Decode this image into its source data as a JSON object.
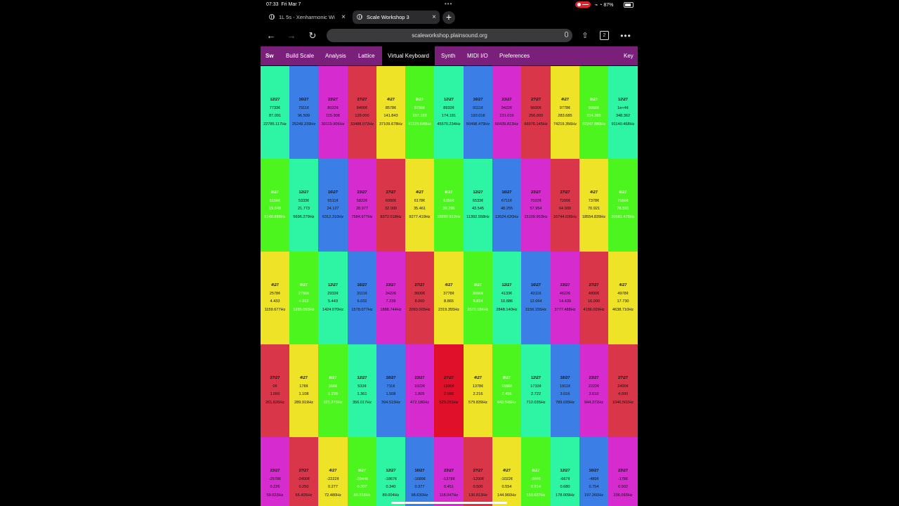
{
  "status_bar": {
    "time": "07:33",
    "date": "Fri Mar 7",
    "battery": "87%"
  },
  "browser": {
    "tabs": [
      {
        "title": "1L 5s - Xenharmonic Wi",
        "close": "×"
      },
      {
        "title": "Scale Workshop 3",
        "close": "×"
      }
    ],
    "new_tab": "+",
    "url": "scaleworkshop.plainsound.org",
    "tab_count": "2",
    "icons": {
      "back": "arrow-left-icon",
      "forward": "arrow-right-icon",
      "reload": "reload-icon",
      "share": "share-icon",
      "more": "more-icon"
    },
    "glyphs": {
      "back": "←",
      "forward": "→",
      "reload": "↻",
      "share": "⇧",
      "more": "•••"
    }
  },
  "app_nav": {
    "items": [
      "Sw",
      "Build Scale",
      "Analysis",
      "Lattice",
      "Virtual Keyboard",
      "Synth",
      "MIDI I/O",
      "Preferences",
      "Key"
    ],
    "active": "Virtual Keyboard"
  },
  "colors": {
    "teal": "#2df5a3",
    "blue": "#3b7ee6",
    "magenta": "#d62ccf",
    "red": "#d9364a",
    "red_active": "#e0102a",
    "yellow": "#efe327",
    "lime": "#4df51f",
    "nav_bg": "#7a1f7a"
  },
  "keyboard": {
    "rows": [
      [
        {
          "color": "teal",
          "lines": [
            "12\\27",
            "7733¢",
            "87.091",
            "22785.117Hz"
          ]
        },
        {
          "color": "blue",
          "lines": [
            "16\\27",
            "7911¢",
            "96.509",
            "25249.239Hz"
          ]
        },
        {
          "color": "magenta",
          "lines": [
            "23\\27",
            "8022¢",
            "115.908",
            "30119.906Hz"
          ]
        },
        {
          "color": "red",
          "lines": [
            "27\\27",
            "8400¢",
            "128.000",
            "33488.072Hz"
          ]
        },
        {
          "color": "yellow",
          "lines": [
            "4\\27",
            "8578¢",
            "141.843",
            "37109.678Hz"
          ]
        },
        {
          "color": "lime",
          "lines": [
            "8\\27",
            "8756¢",
            "157.183",
            "41123.649Hz"
          ]
        },
        {
          "color": "teal",
          "lines": [
            "12\\27",
            "8933¢",
            "174.181",
            "45570.234Hz"
          ]
        },
        {
          "color": "blue",
          "lines": [
            "16\\27",
            "9111¢",
            "193.018",
            "50498.479Hz"
          ]
        },
        {
          "color": "magenta",
          "lines": [
            "23\\27",
            "9422¢",
            "231.016",
            "60439.813Hz"
          ]
        },
        {
          "color": "red",
          "lines": [
            "27\\27",
            "9600¢",
            "256.000",
            "66976.145Hz"
          ]
        },
        {
          "color": "yellow",
          "lines": [
            "4\\27",
            "9778¢",
            "283.685",
            "74219.356Hz"
          ]
        },
        {
          "color": "lime",
          "lines": [
            "8\\27",
            "9956¢",
            "314.365",
            "82247.880Hz"
          ]
        },
        {
          "color": "teal",
          "lines": [
            "12\\27",
            "1e+4¢",
            "348.362",
            "91140.468Hz"
          ]
        }
      ],
      [
        {
          "color": "lime",
          "lines": [
            "8\\27",
            "5156¢",
            "19.648",
            "5140.889Hz"
          ]
        },
        {
          "color": "teal",
          "lines": [
            "12\\27",
            "5333¢",
            "21.773",
            "5696.279Hz"
          ]
        },
        {
          "color": "blue",
          "lines": [
            "16\\27",
            "5511¢",
            "24.127",
            "6312.310Hz"
          ]
        },
        {
          "color": "magenta",
          "lines": [
            "23\\27",
            "5822¢",
            "28.977",
            "7584.977Hz"
          ]
        },
        {
          "color": "red",
          "lines": [
            "27\\27",
            "6000¢",
            "32.000",
            "8372.018Hz"
          ]
        },
        {
          "color": "yellow",
          "lines": [
            "4\\27",
            "6178¢",
            "35.461",
            "9277.419Hz"
          ]
        },
        {
          "color": "lime",
          "lines": [
            "8\\27",
            "6356¢",
            "39.296",
            "10280.912Hz"
          ]
        },
        {
          "color": "teal",
          "lines": [
            "12\\27",
            "6533¢",
            "43.545",
            "11392.558Hz"
          ]
        },
        {
          "color": "blue",
          "lines": [
            "16\\27",
            "6711¢",
            "48.255",
            "12624.620Hz"
          ]
        },
        {
          "color": "magenta",
          "lines": [
            "23\\27",
            "7022¢",
            "57.954",
            "15109.953Hz"
          ]
        },
        {
          "color": "red",
          "lines": [
            "27\\27",
            "7200¢",
            "64.000",
            "16744.036Hz"
          ]
        },
        {
          "color": "yellow",
          "lines": [
            "4\\27",
            "7378¢",
            "70.921",
            "18554.839Hz"
          ]
        },
        {
          "color": "lime",
          "lines": [
            "8\\27",
            "7556¢",
            "78.591",
            "20561.478Hz"
          ]
        }
      ],
      [
        {
          "color": "yellow",
          "lines": [
            "4\\27",
            "2578¢",
            "4.433",
            "1159.677Hz"
          ]
        },
        {
          "color": "lime",
          "lines": [
            "8\\27",
            "2756¢",
            "4.912",
            "1285.093Hz"
          ]
        },
        {
          "color": "teal",
          "lines": [
            "12\\27",
            "2933¢",
            "5.443",
            "1424.070Hz"
          ]
        },
        {
          "color": "blue",
          "lines": [
            "16\\27",
            "3111¢",
            "6.032",
            "1578.077Hz"
          ]
        },
        {
          "color": "magenta",
          "lines": [
            "23\\27",
            "3422¢",
            "7.239",
            "1888.744Hz"
          ]
        },
        {
          "color": "red",
          "lines": [
            "27\\27",
            "3600¢",
            "8.000",
            "2093.005Hz"
          ]
        },
        {
          "color": "yellow",
          "lines": [
            "4\\27",
            "3778¢",
            "8.865",
            "2319.355Hz"
          ]
        },
        {
          "color": "lime",
          "lines": [
            "8\\27",
            "3956¢",
            "9.824",
            "2570.184Hz"
          ]
        },
        {
          "color": "teal",
          "lines": [
            "12\\27",
            "4133¢",
            "10.886",
            "2848.140Hz"
          ]
        },
        {
          "color": "blue",
          "lines": [
            "16\\27",
            "4311¢",
            "12.064",
            "3156.155Hz"
          ]
        },
        {
          "color": "magenta",
          "lines": [
            "23\\27",
            "4622¢",
            "14.439",
            "3777.488Hz"
          ]
        },
        {
          "color": "red",
          "lines": [
            "27\\27",
            "4800¢",
            "16.000",
            "4186.009Hz"
          ]
        },
        {
          "color": "yellow",
          "lines": [
            "4\\27",
            "4978¢",
            "17.730",
            "4638.710Hz"
          ]
        }
      ],
      [
        {
          "color": "red",
          "lines": [
            "27\\27",
            "0¢",
            "1.000",
            "261.626Hz"
          ]
        },
        {
          "color": "yellow",
          "lines": [
            "4\\27",
            "178¢",
            "1.108",
            "289.919Hz"
          ]
        },
        {
          "color": "lime",
          "lines": [
            "8\\27",
            "356¢",
            "1.228",
            "321.273Hz"
          ]
        },
        {
          "color": "teal",
          "lines": [
            "12\\27",
            "533¢",
            "1.361",
            "356.017Hz"
          ]
        },
        {
          "color": "blue",
          "lines": [
            "16\\27",
            "711¢",
            "1.508",
            "394.519Hz"
          ]
        },
        {
          "color": "magenta",
          "lines": [
            "23\\27",
            "1022¢",
            "1.805",
            "472.186Hz"
          ]
        },
        {
          "color": "red_active",
          "lines": [
            "27\\27",
            "1200¢",
            "2.000",
            "523.251Hz"
          ]
        },
        {
          "color": "yellow",
          "lines": [
            "4\\27",
            "1378¢",
            "2.216",
            "579.839Hz"
          ]
        },
        {
          "color": "lime",
          "lines": [
            "8\\27",
            "1556¢",
            "2.456",
            "642.546Hz"
          ]
        },
        {
          "color": "teal",
          "lines": [
            "12\\27",
            "1733¢",
            "2.722",
            "712.035Hz"
          ]
        },
        {
          "color": "blue",
          "lines": [
            "16\\27",
            "1911¢",
            "3.016",
            "789.039Hz"
          ]
        },
        {
          "color": "magenta",
          "lines": [
            "23\\27",
            "2222¢",
            "3.610",
            "944.372Hz"
          ]
        },
        {
          "color": "red",
          "lines": [
            "27\\27",
            "2400¢",
            "4.000",
            "1046.502Hz"
          ]
        }
      ],
      [
        {
          "color": "magenta",
          "lines": [
            "23\\27",
            "-2578¢",
            "0.226",
            "59.023Hz"
          ]
        },
        {
          "color": "red",
          "lines": [
            "27\\27",
            "-2400¢",
            "0.250",
            "65.406Hz"
          ]
        },
        {
          "color": "yellow",
          "lines": [
            "4\\27",
            "-2222¢",
            "0.277",
            "72.480Hz"
          ]
        },
        {
          "color": "lime",
          "lines": [
            "8\\27",
            "-2044¢",
            "0.307",
            "80.318Hz"
          ]
        },
        {
          "color": "teal",
          "lines": [
            "12\\27",
            "-1867¢",
            "0.340",
            "89.004Hz"
          ]
        },
        {
          "color": "blue",
          "lines": [
            "16\\27",
            "-1689¢",
            "0.377",
            "98.630Hz"
          ]
        },
        {
          "color": "magenta",
          "lines": [
            "23\\27",
            "-1378¢",
            "0.451",
            "118.047Hz"
          ]
        },
        {
          "color": "red",
          "lines": [
            "27\\27",
            "-1200¢",
            "0.500",
            "130.813Hz"
          ]
        },
        {
          "color": "yellow",
          "lines": [
            "4\\27",
            "-1022¢",
            "0.554",
            "144.960Hz"
          ]
        },
        {
          "color": "lime",
          "lines": [
            "8\\27",
            "-844¢",
            "0.614",
            "160.637Hz"
          ]
        },
        {
          "color": "teal",
          "lines": [
            "12\\27",
            "-667¢",
            "0.680",
            "178.009Hz"
          ]
        },
        {
          "color": "blue",
          "lines": [
            "16\\27",
            "-489¢",
            "0.754",
            "197.260Hz"
          ]
        },
        {
          "color": "magenta",
          "lines": [
            "23\\27",
            "-178¢",
            "0.902",
            "236.093Hz"
          ]
        }
      ]
    ]
  }
}
